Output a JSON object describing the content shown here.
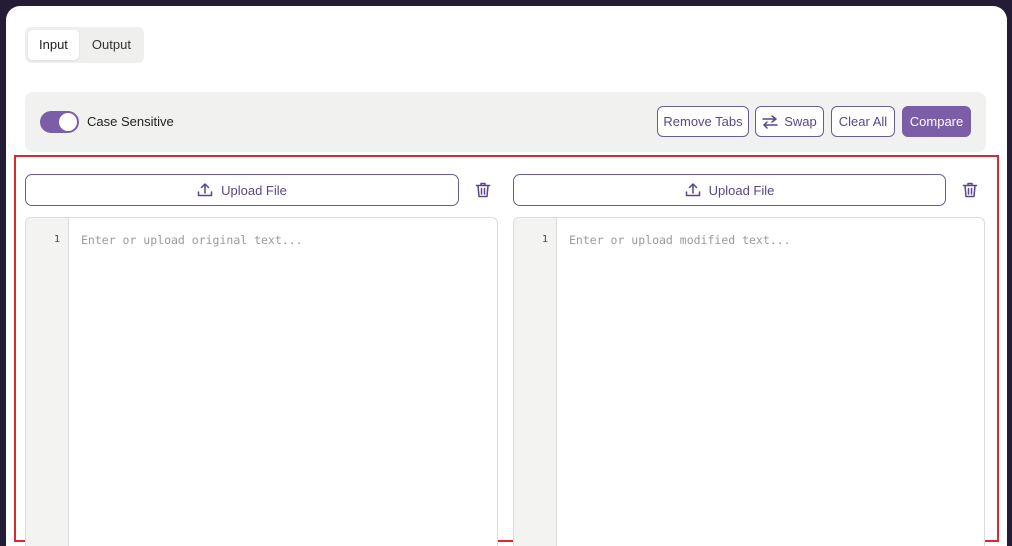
{
  "tabs": [
    {
      "label": "Input",
      "active": true
    },
    {
      "label": "Output",
      "active": false
    }
  ],
  "toolbar": {
    "case_sensitive_label": "Case Sensitive",
    "case_sensitive_on": true,
    "remove_tabs_label": "Remove Tabs",
    "swap_label": "Swap",
    "clear_all_label": "Clear All",
    "compare_label": "Compare"
  },
  "left_panel": {
    "upload_label": "Upload File",
    "line_number": "1",
    "placeholder": "Enter or upload original text..."
  },
  "right_panel": {
    "upload_label": "Upload File",
    "line_number": "1",
    "placeholder": "Enter or upload modified text..."
  },
  "colors": {
    "accent": "#7b5ea7",
    "highlight_border": "#e0262e",
    "background": "#241c36"
  },
  "icons": {
    "upload": "upload-icon",
    "swap": "swap-arrows-icon",
    "delete": "trash-icon"
  }
}
